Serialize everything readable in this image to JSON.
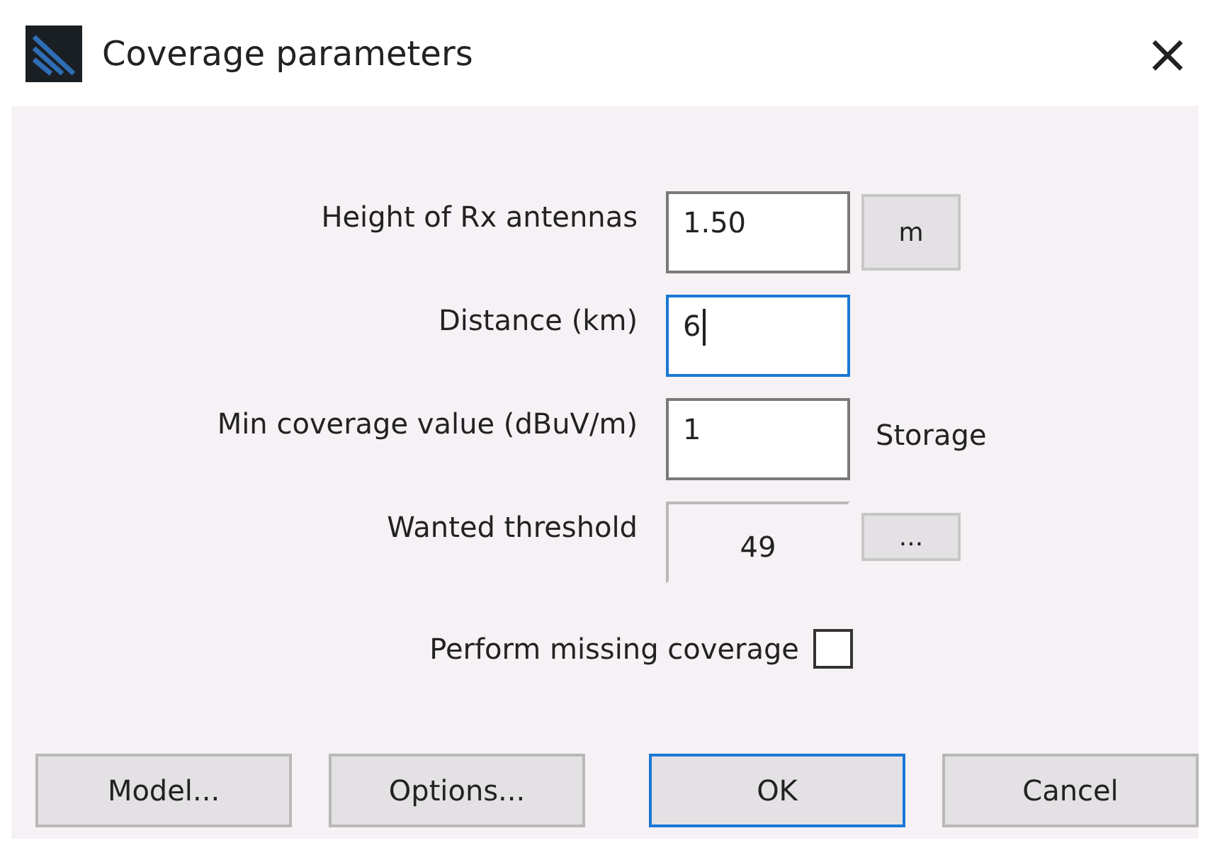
{
  "window": {
    "title": "Coverage parameters",
    "close": "×"
  },
  "fields": [
    {
      "label": "Height of Rx antennas",
      "value": "1.50",
      "focused": false,
      "readonly": false,
      "side": {
        "kind": "button",
        "text": "m"
      }
    },
    {
      "label": "Distance (km)",
      "value": "6",
      "focused": true,
      "readonly": false
    },
    {
      "label": "Min coverage value (dBuV/m)",
      "value": "1",
      "focused": false,
      "readonly": false,
      "side": {
        "kind": "text",
        "text": "Storage"
      }
    },
    {
      "label": "Wanted threshold",
      "value": "49",
      "focused": false,
      "readonly": true,
      "side": {
        "kind": "small-button",
        "text": "..."
      }
    }
  ],
  "checkbox": {
    "label": "Perform missing coverage",
    "checked": false
  },
  "buttons": [
    {
      "label": "Model...",
      "default": false
    },
    {
      "label": "Options...",
      "default": false
    },
    {
      "label": "OK",
      "default": true
    },
    {
      "label": "Cancel",
      "default": false
    }
  ]
}
